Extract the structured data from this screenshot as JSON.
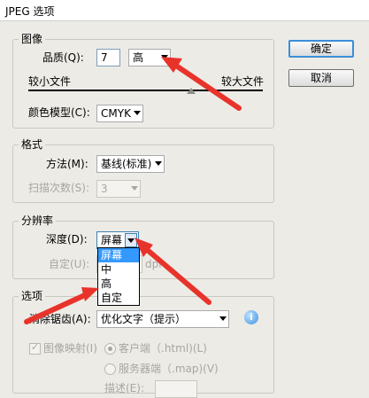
{
  "window": {
    "title": "JPEG 选项"
  },
  "buttons": {
    "ok": "确定",
    "cancel": "取消"
  },
  "image_group": {
    "legend": "图像",
    "quality_label": "品质(Q):",
    "quality_value": "7",
    "quality_level": "高",
    "small_file": "较小文件",
    "large_file": "较大文件",
    "color_model_label": "颜色模型(C):",
    "color_model_value": "CMYK"
  },
  "format_group": {
    "legend": "格式",
    "method_label": "方法(M):",
    "method_value": "基线(标准)",
    "scans_label": "扫描次数(S):",
    "scans_value": "3"
  },
  "resolution_group": {
    "legend": "分辨率",
    "depth_label": "深度(D):",
    "depth_value": "屏幕",
    "custom_label": "自定(U):",
    "custom_unit": "dpi"
  },
  "depth_dropdown": {
    "options": [
      "屏幕",
      "中",
      "高",
      "自定"
    ],
    "selected": "屏幕"
  },
  "options_group": {
    "legend": "选项",
    "antialias_label": "消除锯齿(A):",
    "antialias_value": "优化文字（提示）",
    "imagemap_label": "图像映射(I)",
    "client_side_label": "客户端（.html)(L)",
    "server_side_label": "服务器端（.map)(V)",
    "cut_label": "描述(E):"
  },
  "colors": {
    "annotation_arrow": "#e8332a",
    "selection": "#3399ff",
    "default_button_border": "#3a8fd9"
  }
}
